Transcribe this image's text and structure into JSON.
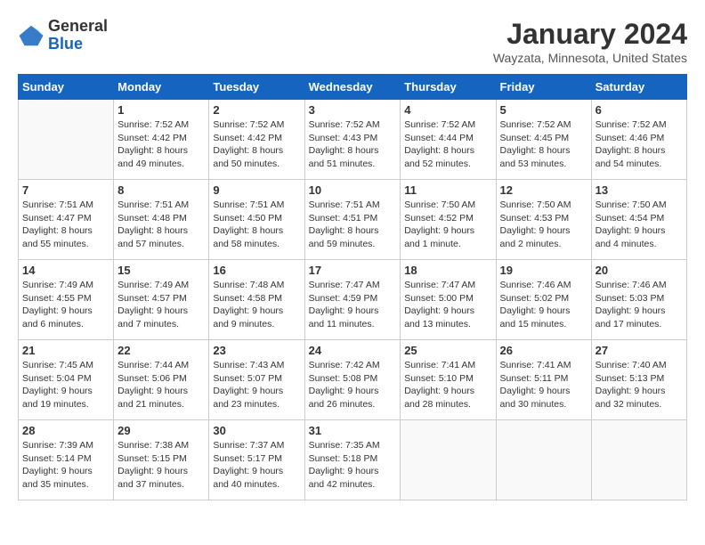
{
  "header": {
    "logo_general": "General",
    "logo_blue": "Blue",
    "month_title": "January 2024",
    "location": "Wayzata, Minnesota, United States"
  },
  "days_of_week": [
    "Sunday",
    "Monday",
    "Tuesday",
    "Wednesday",
    "Thursday",
    "Friday",
    "Saturday"
  ],
  "weeks": [
    [
      {
        "day": "",
        "info": ""
      },
      {
        "day": "1",
        "info": "Sunrise: 7:52 AM\nSunset: 4:42 PM\nDaylight: 8 hours\nand 49 minutes."
      },
      {
        "day": "2",
        "info": "Sunrise: 7:52 AM\nSunset: 4:42 PM\nDaylight: 8 hours\nand 50 minutes."
      },
      {
        "day": "3",
        "info": "Sunrise: 7:52 AM\nSunset: 4:43 PM\nDaylight: 8 hours\nand 51 minutes."
      },
      {
        "day": "4",
        "info": "Sunrise: 7:52 AM\nSunset: 4:44 PM\nDaylight: 8 hours\nand 52 minutes."
      },
      {
        "day": "5",
        "info": "Sunrise: 7:52 AM\nSunset: 4:45 PM\nDaylight: 8 hours\nand 53 minutes."
      },
      {
        "day": "6",
        "info": "Sunrise: 7:52 AM\nSunset: 4:46 PM\nDaylight: 8 hours\nand 54 minutes."
      }
    ],
    [
      {
        "day": "7",
        "info": "Sunrise: 7:51 AM\nSunset: 4:47 PM\nDaylight: 8 hours\nand 55 minutes."
      },
      {
        "day": "8",
        "info": "Sunrise: 7:51 AM\nSunset: 4:48 PM\nDaylight: 8 hours\nand 57 minutes."
      },
      {
        "day": "9",
        "info": "Sunrise: 7:51 AM\nSunset: 4:50 PM\nDaylight: 8 hours\nand 58 minutes."
      },
      {
        "day": "10",
        "info": "Sunrise: 7:51 AM\nSunset: 4:51 PM\nDaylight: 8 hours\nand 59 minutes."
      },
      {
        "day": "11",
        "info": "Sunrise: 7:50 AM\nSunset: 4:52 PM\nDaylight: 9 hours\nand 1 minute."
      },
      {
        "day": "12",
        "info": "Sunrise: 7:50 AM\nSunset: 4:53 PM\nDaylight: 9 hours\nand 2 minutes."
      },
      {
        "day": "13",
        "info": "Sunrise: 7:50 AM\nSunset: 4:54 PM\nDaylight: 9 hours\nand 4 minutes."
      }
    ],
    [
      {
        "day": "14",
        "info": "Sunrise: 7:49 AM\nSunset: 4:55 PM\nDaylight: 9 hours\nand 6 minutes."
      },
      {
        "day": "15",
        "info": "Sunrise: 7:49 AM\nSunset: 4:57 PM\nDaylight: 9 hours\nand 7 minutes."
      },
      {
        "day": "16",
        "info": "Sunrise: 7:48 AM\nSunset: 4:58 PM\nDaylight: 9 hours\nand 9 minutes."
      },
      {
        "day": "17",
        "info": "Sunrise: 7:47 AM\nSunset: 4:59 PM\nDaylight: 9 hours\nand 11 minutes."
      },
      {
        "day": "18",
        "info": "Sunrise: 7:47 AM\nSunset: 5:00 PM\nDaylight: 9 hours\nand 13 minutes."
      },
      {
        "day": "19",
        "info": "Sunrise: 7:46 AM\nSunset: 5:02 PM\nDaylight: 9 hours\nand 15 minutes."
      },
      {
        "day": "20",
        "info": "Sunrise: 7:46 AM\nSunset: 5:03 PM\nDaylight: 9 hours\nand 17 minutes."
      }
    ],
    [
      {
        "day": "21",
        "info": "Sunrise: 7:45 AM\nSunset: 5:04 PM\nDaylight: 9 hours\nand 19 minutes."
      },
      {
        "day": "22",
        "info": "Sunrise: 7:44 AM\nSunset: 5:06 PM\nDaylight: 9 hours\nand 21 minutes."
      },
      {
        "day": "23",
        "info": "Sunrise: 7:43 AM\nSunset: 5:07 PM\nDaylight: 9 hours\nand 23 minutes."
      },
      {
        "day": "24",
        "info": "Sunrise: 7:42 AM\nSunset: 5:08 PM\nDaylight: 9 hours\nand 26 minutes."
      },
      {
        "day": "25",
        "info": "Sunrise: 7:41 AM\nSunset: 5:10 PM\nDaylight: 9 hours\nand 28 minutes."
      },
      {
        "day": "26",
        "info": "Sunrise: 7:41 AM\nSunset: 5:11 PM\nDaylight: 9 hours\nand 30 minutes."
      },
      {
        "day": "27",
        "info": "Sunrise: 7:40 AM\nSunset: 5:13 PM\nDaylight: 9 hours\nand 32 minutes."
      }
    ],
    [
      {
        "day": "28",
        "info": "Sunrise: 7:39 AM\nSunset: 5:14 PM\nDaylight: 9 hours\nand 35 minutes."
      },
      {
        "day": "29",
        "info": "Sunrise: 7:38 AM\nSunset: 5:15 PM\nDaylight: 9 hours\nand 37 minutes."
      },
      {
        "day": "30",
        "info": "Sunrise: 7:37 AM\nSunset: 5:17 PM\nDaylight: 9 hours\nand 40 minutes."
      },
      {
        "day": "31",
        "info": "Sunrise: 7:35 AM\nSunset: 5:18 PM\nDaylight: 9 hours\nand 42 minutes."
      },
      {
        "day": "",
        "info": ""
      },
      {
        "day": "",
        "info": ""
      },
      {
        "day": "",
        "info": ""
      }
    ]
  ]
}
